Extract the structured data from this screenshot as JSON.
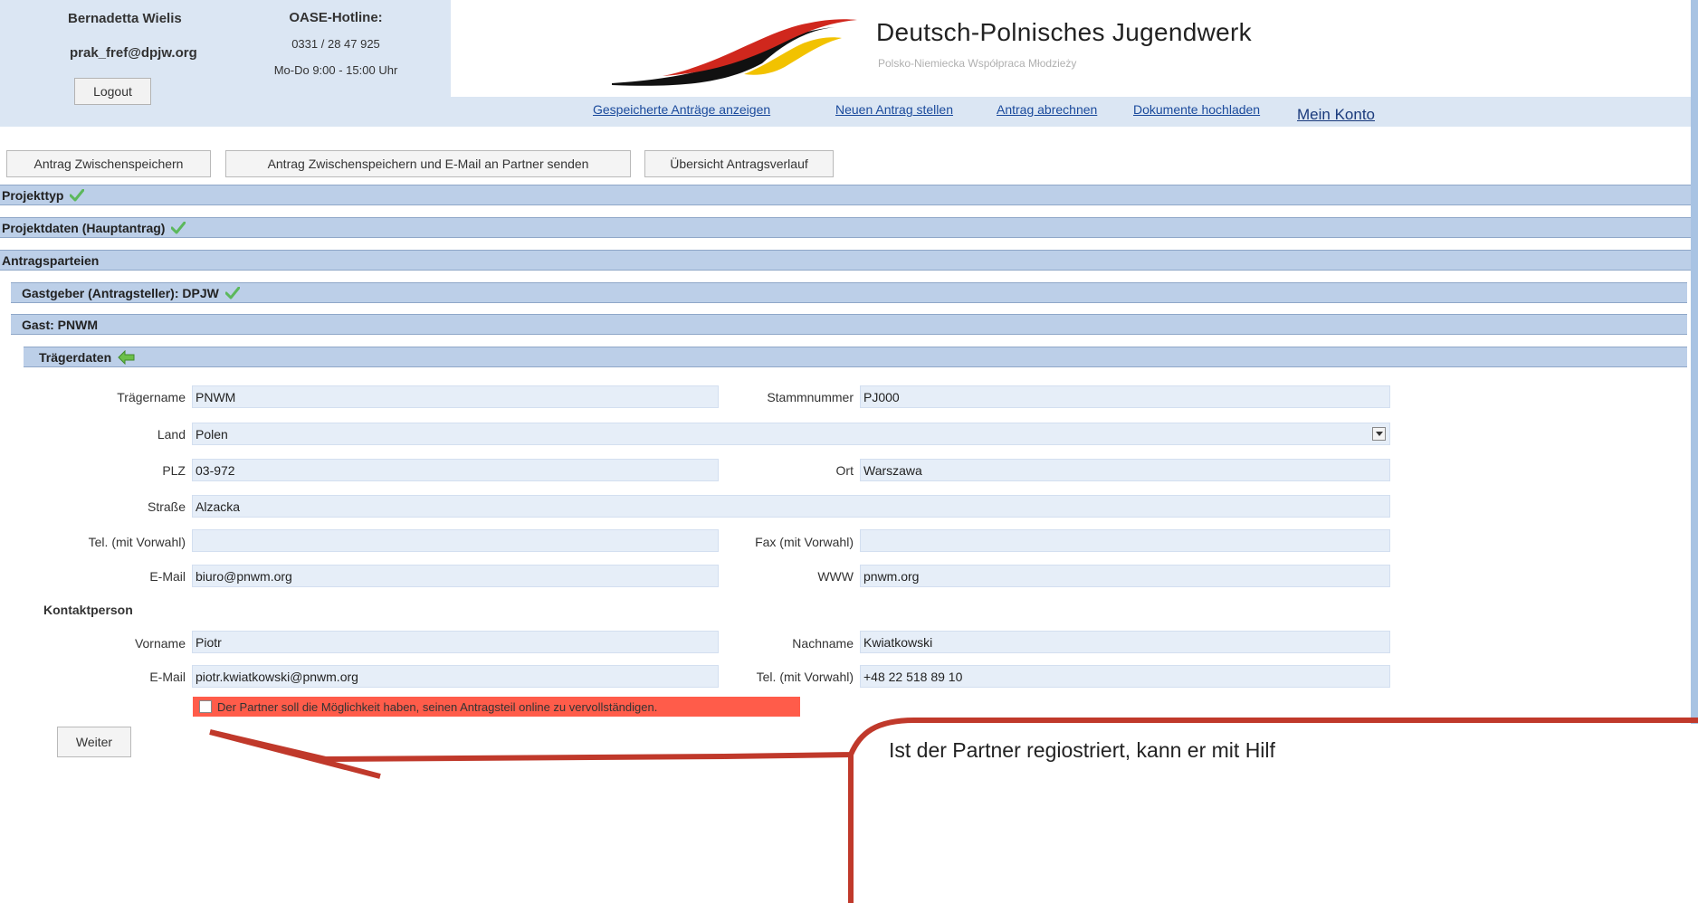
{
  "header": {
    "user_name": "Bernadetta Wielis",
    "user_email": "prak_fref@dpjw.org",
    "logout_label": "Logout",
    "hotline_title": "OASE-Hotline:",
    "hotline_phone": "0331 / 28 47 925",
    "hotline_hours": "Mo-Do 9:00 - 15:00 Uhr",
    "logo_title": "Deutsch-Polnisches Jugendwerk",
    "logo_subtitle": "Polsko-Niemiecka Współpraca Młodzieży"
  },
  "nav": {
    "saved_applications": "Gespeicherte Anträge anzeigen",
    "new_application": "Neuen Antrag stellen",
    "settle_application": "Antrag abrechnen",
    "upload_documents": "Dokumente hochladen",
    "my_account": "Mein Konto"
  },
  "actions": {
    "save_draft": "Antrag Zwischenspeichern",
    "save_and_email": "Antrag Zwischenspeichern und E-Mail an Partner senden",
    "overview_history": "Übersicht Antragsverlauf"
  },
  "sections": {
    "project_type": "Projekttyp",
    "project_data": "Projektdaten (Hauptantrag)",
    "parties": "Antragsparteien",
    "host": "Gastgeber (Antragsteller): DPJW",
    "guest": "Gast: PNWM",
    "carrier_data": "Trägerdaten"
  },
  "form": {
    "labels": {
      "name": "Trägername",
      "registry_number": "Stammnummer",
      "country": "Land",
      "postal_code": "PLZ",
      "city": "Ort",
      "street": "Straße",
      "phone": "Tel. (mit Vorwahl)",
      "fax": "Fax (mit Vorwahl)",
      "email": "E-Mail",
      "www": "WWW"
    },
    "values": {
      "name": "PNWM",
      "registry_number": "PJ000",
      "country": "Polen",
      "postal_code": "03-972",
      "city": "Warszawa",
      "street": "Alzacka",
      "phone": "",
      "fax": "",
      "email": "biuro@pnwm.org",
      "www": "pnwm.org"
    },
    "contact_heading": "Kontaktperson",
    "contact_labels": {
      "first_name": "Vorname",
      "last_name": "Nachname",
      "email": "E-Mail",
      "phone": "Tel. (mit Vorwahl)"
    },
    "contact_values": {
      "first_name": "Piotr",
      "last_name": "Kwiatkowski",
      "email": "piotr.kwiatkowski@pnwm.org",
      "phone": "+48 22 518 89 10"
    },
    "partner_checkbox_label": "Der Partner soll die Möglichkeit haben, seinen Antragsteil online zu vervollständigen.",
    "partner_checkbox_checked": false,
    "next_label": "Weiter"
  },
  "callout": {
    "text": "Ist der Partner regiostriert, kann er mit Hilf"
  },
  "colors": {
    "section_bar": "#bccfe8",
    "input_bg": "#e6eef8",
    "checkbox_highlight": "#ff5c4a",
    "callout_stroke": "#c0392b",
    "check_green": "#5cb85c",
    "link": "#1a4a9c"
  }
}
